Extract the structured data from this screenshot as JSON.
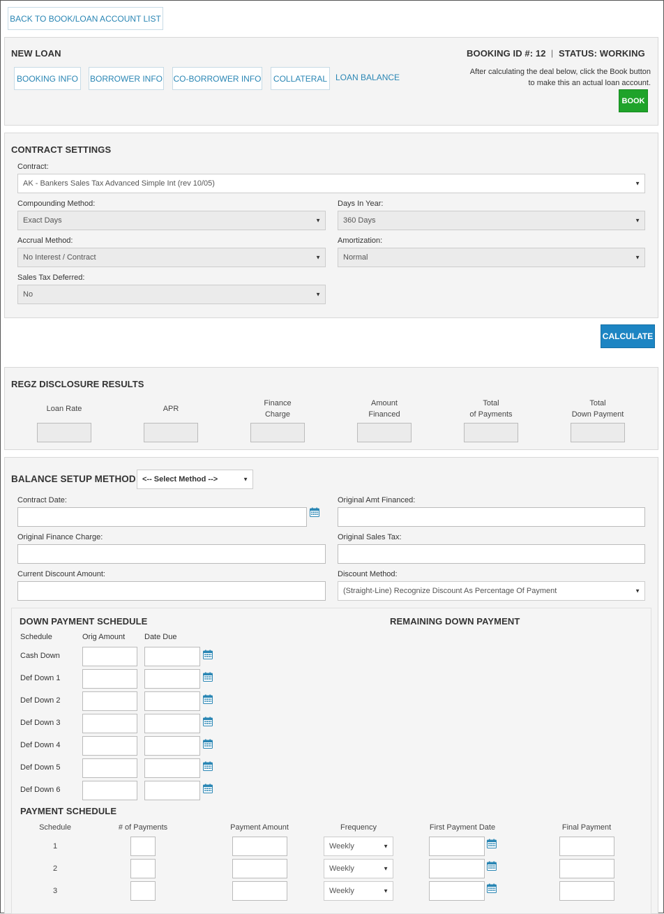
{
  "back_button": "BACK TO BOOK/LOAN ACCOUNT LIST",
  "header": {
    "title": "NEW LOAN",
    "booking_id": "BOOKING ID #: 12",
    "separator": "|",
    "status": "STATUS: WORKING",
    "note_line1": "After calculating the deal below, click the Book button",
    "note_line2": "to make this an actual loan account.",
    "book_label": "BOOK",
    "tabs": [
      "BOOKING INFO",
      "BORROWER INFO",
      "CO-BORROWER INFO",
      "COLLATERAL",
      "LOAN BALANCE"
    ]
  },
  "contract_settings": {
    "title": "CONTRACT SETTINGS",
    "contract_label": "Contract:",
    "contract_value": "AK - Bankers Sales Tax Advanced Simple Int (rev 10/05)",
    "compounding_label": "Compounding Method:",
    "compounding_value": "Exact Days",
    "days_label": "Days In Year:",
    "days_value": "360 Days",
    "accrual_label": "Accrual Method:",
    "accrual_value": "No Interest / Contract",
    "amortization_label": "Amortization:",
    "amortization_value": "Normal",
    "sales_tax_label": "Sales Tax Deferred:",
    "sales_tax_value": "No"
  },
  "calculate_label": "CALCULATE",
  "regz": {
    "title": "REGZ DISCLOSURE RESULTS",
    "columns": [
      [
        "Loan Rate"
      ],
      [
        "APR"
      ],
      [
        "Finance",
        "Charge"
      ],
      [
        "Amount",
        "Financed"
      ],
      [
        "Total",
        "of Payments"
      ],
      [
        "Total",
        "Down Payment"
      ]
    ]
  },
  "balance": {
    "title": "BALANCE SETUP METHOD:",
    "method_value": "<-- Select Method -->",
    "contract_date_label": "Contract Date:",
    "orig_amt_label": "Original Amt Financed:",
    "orig_fin_label": "Original Finance Charge:",
    "orig_tax_label": "Original Sales Tax:",
    "discount_amt_label": "Current Discount Amount:",
    "discount_method_label": "Discount Method:",
    "discount_method_value": "(Straight-Line) Recognize Discount As Percentage Of Payment"
  },
  "down_payment": {
    "title": "DOWN PAYMENT SCHEDULE",
    "remaining_title": "REMAINING DOWN PAYMENT",
    "col_schedule": "Schedule",
    "col_amount": "Orig Amount",
    "col_date": "Date Due",
    "rows": [
      "Cash Down",
      "Def Down 1",
      "Def Down 2",
      "Def Down 3",
      "Def Down 4",
      "Def Down 5",
      "Def Down 6"
    ]
  },
  "payment_schedule": {
    "title": "PAYMENT SCHEDULE",
    "col_schedule": "Schedule",
    "col_num": "# of Payments",
    "col_amount": "Payment Amount",
    "col_freq": "Frequency",
    "col_first": "First Payment Date",
    "col_final": "Final Payment",
    "rows": [
      {
        "n": "1",
        "freq": "Weekly"
      },
      {
        "n": "2",
        "freq": "Weekly"
      },
      {
        "n": "3",
        "freq": "Weekly"
      }
    ]
  },
  "colors": {
    "link": "#2a86b4",
    "book_button": "#1fa32a",
    "calculate_button": "#1d85c3",
    "calendar_icon": "#2a86b4"
  }
}
